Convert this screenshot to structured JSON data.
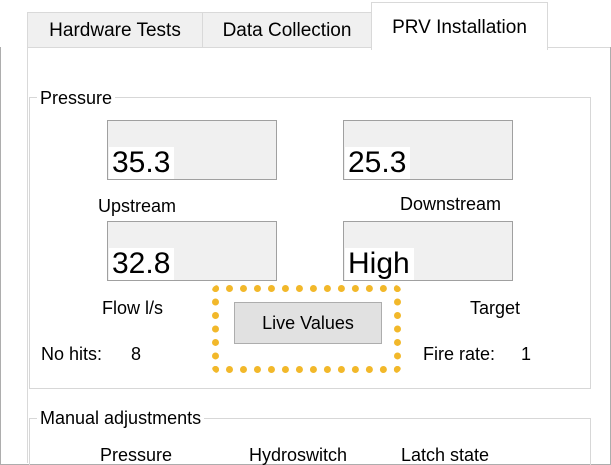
{
  "tabs": [
    {
      "label": "Hardware Tests",
      "active": false
    },
    {
      "label": "Data Collection",
      "active": false
    },
    {
      "label": "PRV Installation",
      "active": true
    }
  ],
  "pressure_group": {
    "title": "Pressure",
    "upstream": {
      "value": "35.3",
      "label": "Upstream"
    },
    "downstream": {
      "value": "25.3",
      "label": "Downstream"
    },
    "flow": {
      "value": "32.8",
      "label": "Flow l/s"
    },
    "target": {
      "value": "High",
      "label": "Target"
    },
    "no_hits": {
      "label": "No hits:",
      "value": "8"
    },
    "fire_rate": {
      "label": "Fire rate:",
      "value": "1"
    },
    "live_values_button": "Live Values",
    "highlight_color": "#f2b82a"
  },
  "manual_group": {
    "title": "Manual adjustments",
    "columns": [
      "Pressure",
      "Hydroswitch",
      "Latch state"
    ]
  }
}
